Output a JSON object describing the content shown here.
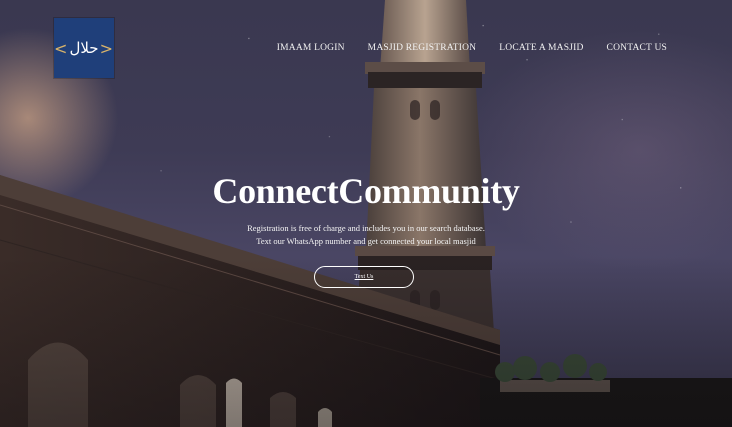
{
  "logo": {
    "left_bracket": "<",
    "arabic_text": "حلال",
    "right_bracket": ">",
    "background_color": "#1f3f7a",
    "bracket_color": "#d9b46a"
  },
  "nav": {
    "items": [
      {
        "label": "IMAAM LOGIN"
      },
      {
        "label": "MASJID REGISTRATION"
      },
      {
        "label": "LOCATE A MASJID"
      },
      {
        "label": "CONTACT US"
      }
    ]
  },
  "hero": {
    "headline": "ConnectCommunity",
    "subtext_line1": "Registration is free of charge and includes you in our search database.",
    "subtext_line2": "Text our WhatsApp number and get connected your local masjid",
    "cta_label": "Text Us"
  },
  "colors": {
    "sky": "#3e3b55",
    "text": "#ffffff"
  },
  "icons": [
    "logo-emblem",
    "mosque-minaret-background"
  ]
}
